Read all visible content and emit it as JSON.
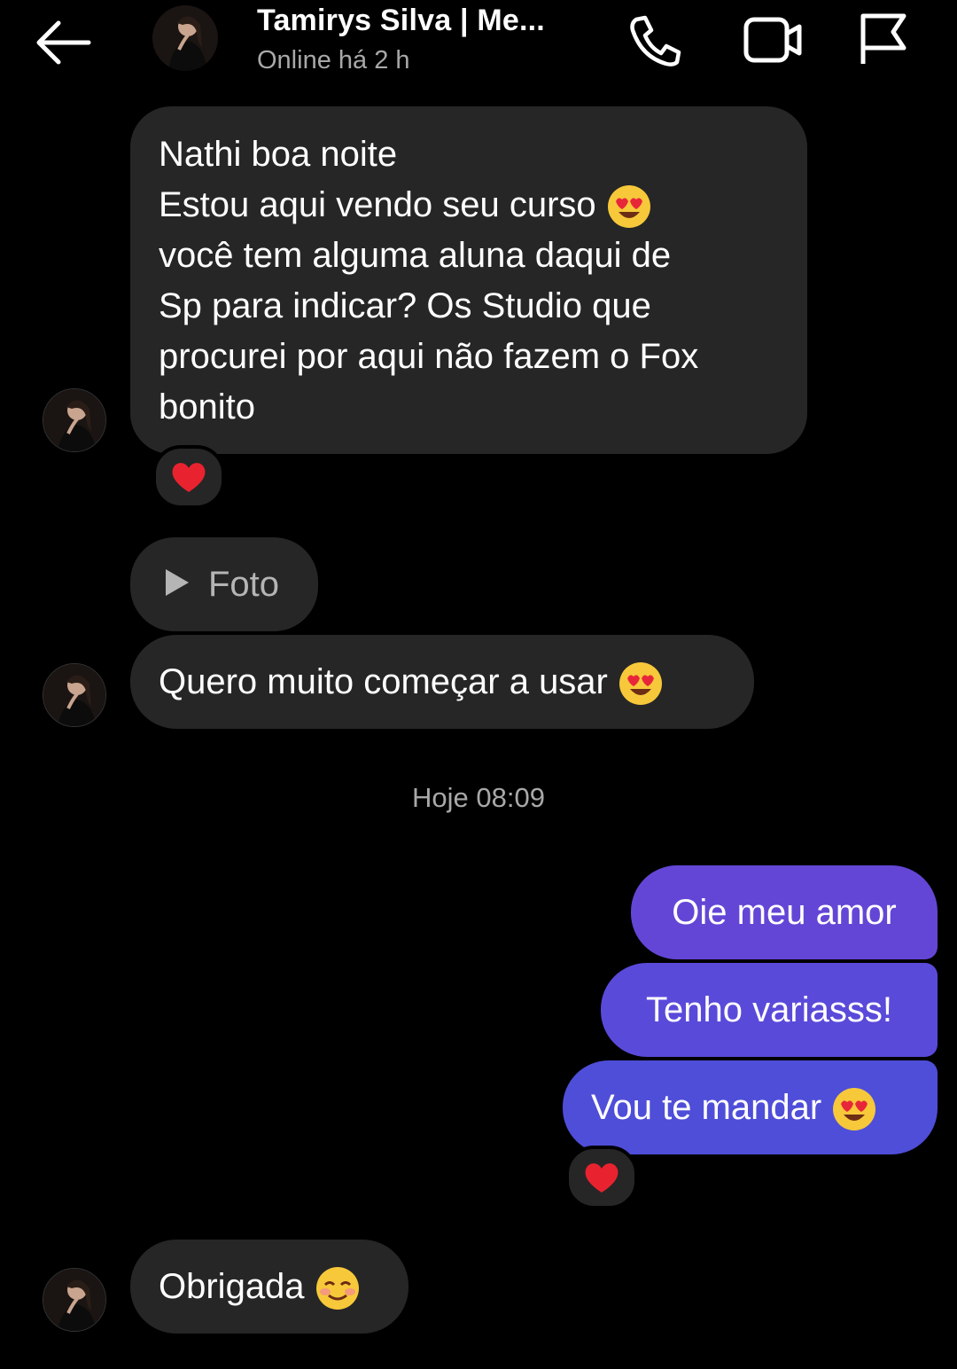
{
  "header": {
    "contact_name": "Tamirys Silva | Me...",
    "status": "Online há 2 h",
    "back_icon": "arrow-left-icon",
    "call_icon": "phone-icon",
    "video_icon": "video-camera-icon",
    "report_icon": "flag-icon"
  },
  "messages": {
    "m1_lines": [
      "Nathi boa noite",
      "Estou aqui vendo seu curso",
      "você tem alguma aluna daqui de",
      "Sp para indicar? Os Studio que",
      "procurei por aqui não fazem o Fox",
      "bonito"
    ],
    "m1_reaction": "heart",
    "foto_label": "Foto",
    "m2": "Quero muito começar a usar",
    "timestamp": "Hoje 08:09",
    "out1": "Oie meu amor",
    "out2": "Tenho variasss!",
    "out3": "Vou te mandar",
    "out3_reaction": "heart",
    "m3": "Obrigada"
  },
  "colors": {
    "background": "#000000",
    "incoming_bubble": "#262626",
    "outgoing_top": "#6446d6",
    "outgoing_bottom": "#4f4ed9",
    "secondary_text": "#a8a8a8"
  }
}
